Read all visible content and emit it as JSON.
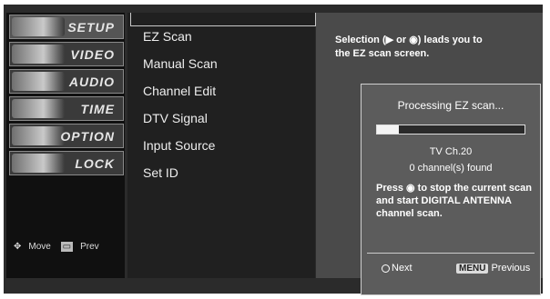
{
  "menu": {
    "items": [
      {
        "label": "SETUP",
        "active": true
      },
      {
        "label": "VIDEO",
        "active": false
      },
      {
        "label": "AUDIO",
        "active": false
      },
      {
        "label": "TIME",
        "active": false
      },
      {
        "label": "OPTION",
        "active": false
      },
      {
        "label": "LOCK",
        "active": false
      }
    ]
  },
  "help": {
    "move": "Move",
    "prev": "Prev"
  },
  "submenu": {
    "items": [
      "EZ Scan",
      "Manual Scan",
      "Channel Edit",
      "DTV Signal",
      "Input Source",
      "Set ID"
    ]
  },
  "description": "Selection (▶ or ◉) leads you to the EZ scan screen.",
  "popup": {
    "title": "Processing EZ scan...",
    "progress": 0.15,
    "channel": "TV Ch.20",
    "found": "0 channel(s) found",
    "press_msg": "Press ◉ to stop the current scan and start DIGITAL ANTENNA channel scan.",
    "next_label": "Next",
    "menu_key": "MENU",
    "previous_label": "Previous"
  }
}
